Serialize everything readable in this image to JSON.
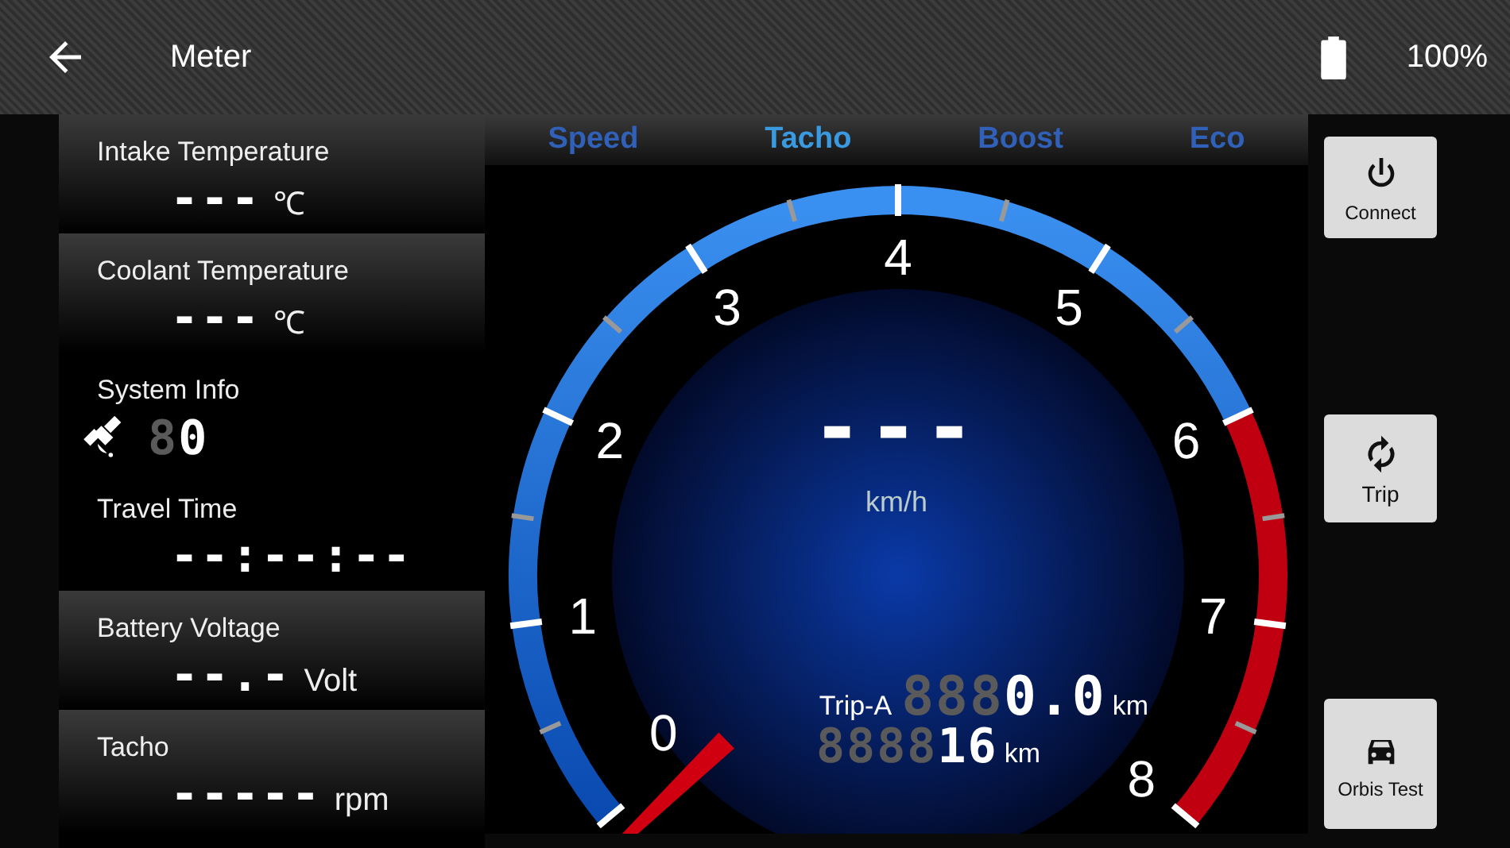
{
  "app_bar": {
    "title": "Meter",
    "battery": "100%"
  },
  "readouts": [
    {
      "kind": "value",
      "title": "Intake Temperature",
      "value": "---",
      "unit": "℃"
    },
    {
      "kind": "value",
      "title": "Coolant Temperature",
      "value": "---",
      "unit": "℃"
    },
    {
      "kind": "system",
      "title": "System Info",
      "ghost": "8",
      "value": "0"
    },
    {
      "kind": "value",
      "title": "Travel Time",
      "value": "--:--:--"
    },
    {
      "kind": "value",
      "title": "Battery Voltage",
      "value": "--.-",
      "unit": "Volt"
    },
    {
      "kind": "value",
      "title": "Tacho",
      "value": "-----",
      "unit": "rpm"
    }
  ],
  "tabs": [
    {
      "label": "Speed",
      "selected": false
    },
    {
      "label": "Tacho",
      "selected": true
    },
    {
      "label": "Boost",
      "selected": false
    },
    {
      "label": "Eco",
      "selected": false
    }
  ],
  "gauge": {
    "labels": [
      {
        "text": "0",
        "kind": "normal"
      },
      {
        "text": "1",
        "kind": "normal"
      },
      {
        "text": "2",
        "kind": "normal"
      },
      {
        "text": "3",
        "kind": "normal"
      },
      {
        "text": "4",
        "kind": "normal"
      },
      {
        "text": "5",
        "kind": "normal"
      },
      {
        "text": "6",
        "kind": "red"
      },
      {
        "text": "7",
        "kind": "red"
      },
      {
        "text": "8",
        "kind": "red"
      }
    ],
    "speed": "---",
    "speed_unit": "km/h",
    "trip_label": "Trip-A",
    "trip_ghost": "888",
    "trip": "0.0",
    "trip_unit": "km",
    "odo_ghost": "8888",
    "odo": "16",
    "odo_unit": "km"
  },
  "buttons": [
    {
      "kind": "power",
      "label": "Connect"
    },
    {
      "kind": "refresh",
      "label": "Trip"
    },
    {
      "kind": "car",
      "label": "Orbis Test"
    }
  ]
}
